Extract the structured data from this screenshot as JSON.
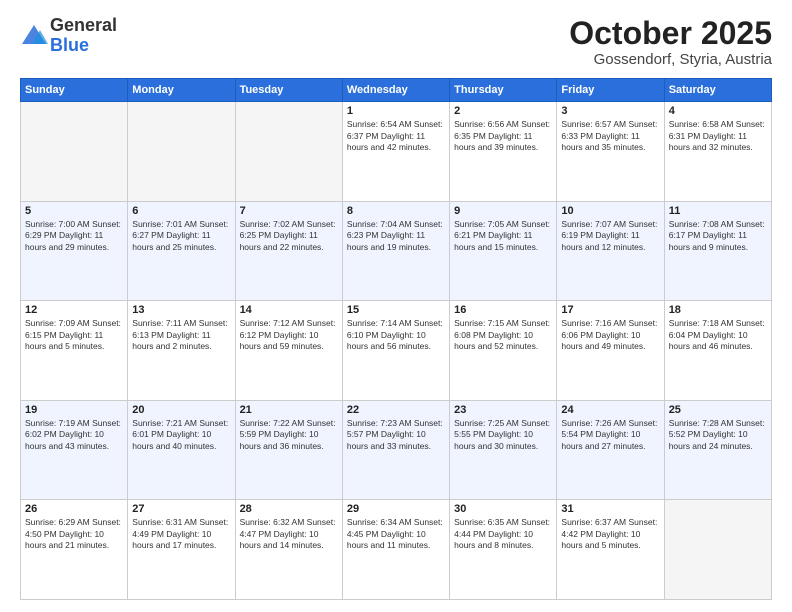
{
  "logo": {
    "general": "General",
    "blue": "Blue"
  },
  "header": {
    "month": "October 2025",
    "location": "Gossendorf, Styria, Austria"
  },
  "weekdays": [
    "Sunday",
    "Monday",
    "Tuesday",
    "Wednesday",
    "Thursday",
    "Friday",
    "Saturday"
  ],
  "weeks": [
    [
      {
        "day": "",
        "info": ""
      },
      {
        "day": "",
        "info": ""
      },
      {
        "day": "",
        "info": ""
      },
      {
        "day": "1",
        "info": "Sunrise: 6:54 AM\nSunset: 6:37 PM\nDaylight: 11 hours\nand 42 minutes."
      },
      {
        "day": "2",
        "info": "Sunrise: 6:56 AM\nSunset: 6:35 PM\nDaylight: 11 hours\nand 39 minutes."
      },
      {
        "day": "3",
        "info": "Sunrise: 6:57 AM\nSunset: 6:33 PM\nDaylight: 11 hours\nand 35 minutes."
      },
      {
        "day": "4",
        "info": "Sunrise: 6:58 AM\nSunset: 6:31 PM\nDaylight: 11 hours\nand 32 minutes."
      }
    ],
    [
      {
        "day": "5",
        "info": "Sunrise: 7:00 AM\nSunset: 6:29 PM\nDaylight: 11 hours\nand 29 minutes."
      },
      {
        "day": "6",
        "info": "Sunrise: 7:01 AM\nSunset: 6:27 PM\nDaylight: 11 hours\nand 25 minutes."
      },
      {
        "day": "7",
        "info": "Sunrise: 7:02 AM\nSunset: 6:25 PM\nDaylight: 11 hours\nand 22 minutes."
      },
      {
        "day": "8",
        "info": "Sunrise: 7:04 AM\nSunset: 6:23 PM\nDaylight: 11 hours\nand 19 minutes."
      },
      {
        "day": "9",
        "info": "Sunrise: 7:05 AM\nSunset: 6:21 PM\nDaylight: 11 hours\nand 15 minutes."
      },
      {
        "day": "10",
        "info": "Sunrise: 7:07 AM\nSunset: 6:19 PM\nDaylight: 11 hours\nand 12 minutes."
      },
      {
        "day": "11",
        "info": "Sunrise: 7:08 AM\nSunset: 6:17 PM\nDaylight: 11 hours\nand 9 minutes."
      }
    ],
    [
      {
        "day": "12",
        "info": "Sunrise: 7:09 AM\nSunset: 6:15 PM\nDaylight: 11 hours\nand 5 minutes."
      },
      {
        "day": "13",
        "info": "Sunrise: 7:11 AM\nSunset: 6:13 PM\nDaylight: 11 hours\nand 2 minutes."
      },
      {
        "day": "14",
        "info": "Sunrise: 7:12 AM\nSunset: 6:12 PM\nDaylight: 10 hours\nand 59 minutes."
      },
      {
        "day": "15",
        "info": "Sunrise: 7:14 AM\nSunset: 6:10 PM\nDaylight: 10 hours\nand 56 minutes."
      },
      {
        "day": "16",
        "info": "Sunrise: 7:15 AM\nSunset: 6:08 PM\nDaylight: 10 hours\nand 52 minutes."
      },
      {
        "day": "17",
        "info": "Sunrise: 7:16 AM\nSunset: 6:06 PM\nDaylight: 10 hours\nand 49 minutes."
      },
      {
        "day": "18",
        "info": "Sunrise: 7:18 AM\nSunset: 6:04 PM\nDaylight: 10 hours\nand 46 minutes."
      }
    ],
    [
      {
        "day": "19",
        "info": "Sunrise: 7:19 AM\nSunset: 6:02 PM\nDaylight: 10 hours\nand 43 minutes."
      },
      {
        "day": "20",
        "info": "Sunrise: 7:21 AM\nSunset: 6:01 PM\nDaylight: 10 hours\nand 40 minutes."
      },
      {
        "day": "21",
        "info": "Sunrise: 7:22 AM\nSunset: 5:59 PM\nDaylight: 10 hours\nand 36 minutes."
      },
      {
        "day": "22",
        "info": "Sunrise: 7:23 AM\nSunset: 5:57 PM\nDaylight: 10 hours\nand 33 minutes."
      },
      {
        "day": "23",
        "info": "Sunrise: 7:25 AM\nSunset: 5:55 PM\nDaylight: 10 hours\nand 30 minutes."
      },
      {
        "day": "24",
        "info": "Sunrise: 7:26 AM\nSunset: 5:54 PM\nDaylight: 10 hours\nand 27 minutes."
      },
      {
        "day": "25",
        "info": "Sunrise: 7:28 AM\nSunset: 5:52 PM\nDaylight: 10 hours\nand 24 minutes."
      }
    ],
    [
      {
        "day": "26",
        "info": "Sunrise: 6:29 AM\nSunset: 4:50 PM\nDaylight: 10 hours\nand 21 minutes."
      },
      {
        "day": "27",
        "info": "Sunrise: 6:31 AM\nSunset: 4:49 PM\nDaylight: 10 hours\nand 17 minutes."
      },
      {
        "day": "28",
        "info": "Sunrise: 6:32 AM\nSunset: 4:47 PM\nDaylight: 10 hours\nand 14 minutes."
      },
      {
        "day": "29",
        "info": "Sunrise: 6:34 AM\nSunset: 4:45 PM\nDaylight: 10 hours\nand 11 minutes."
      },
      {
        "day": "30",
        "info": "Sunrise: 6:35 AM\nSunset: 4:44 PM\nDaylight: 10 hours\nand 8 minutes."
      },
      {
        "day": "31",
        "info": "Sunrise: 6:37 AM\nSunset: 4:42 PM\nDaylight: 10 hours\nand 5 minutes."
      },
      {
        "day": "",
        "info": ""
      }
    ]
  ]
}
